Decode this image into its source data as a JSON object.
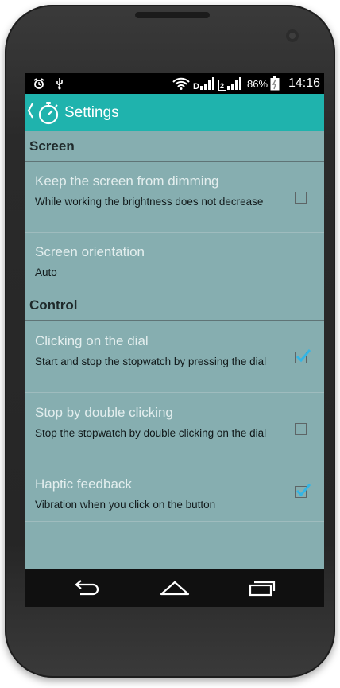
{
  "statusbar": {
    "battery": "86%",
    "time": "14:16",
    "icons": [
      "alarm-clock-icon",
      "usb-icon",
      "wifi-icon",
      "signal-sim1-icon",
      "signal-sim2-icon",
      "battery-charging-icon"
    ]
  },
  "appbar": {
    "title": "Settings",
    "icon": "stopwatch-icon"
  },
  "sections": {
    "screen": {
      "header": "Screen",
      "keep_screen": {
        "title": "Keep the screen from dimming",
        "summary": "While working the brightness does not decrease",
        "checked": false
      },
      "orientation": {
        "title": "Screen orientation",
        "summary": "Auto"
      }
    },
    "control": {
      "header": "Control",
      "click_dial": {
        "title": "Clicking on the dial",
        "summary": "Start and stop the stopwatch by pressing the dial",
        "checked": true
      },
      "double_click": {
        "title": "Stop by double clicking",
        "summary": "Stop the stopwatch by double clicking on the dial",
        "checked": false
      },
      "haptic": {
        "title": "Haptic feedback",
        "summary": "Vibration when you click on the button",
        "checked": true
      }
    }
  },
  "navbar": {
    "icons": [
      "back-icon",
      "home-icon",
      "recents-icon"
    ]
  },
  "colors": {
    "accent": "#1fb3ad",
    "list_bg": "#86aeb0",
    "check": "#33b5e5"
  }
}
